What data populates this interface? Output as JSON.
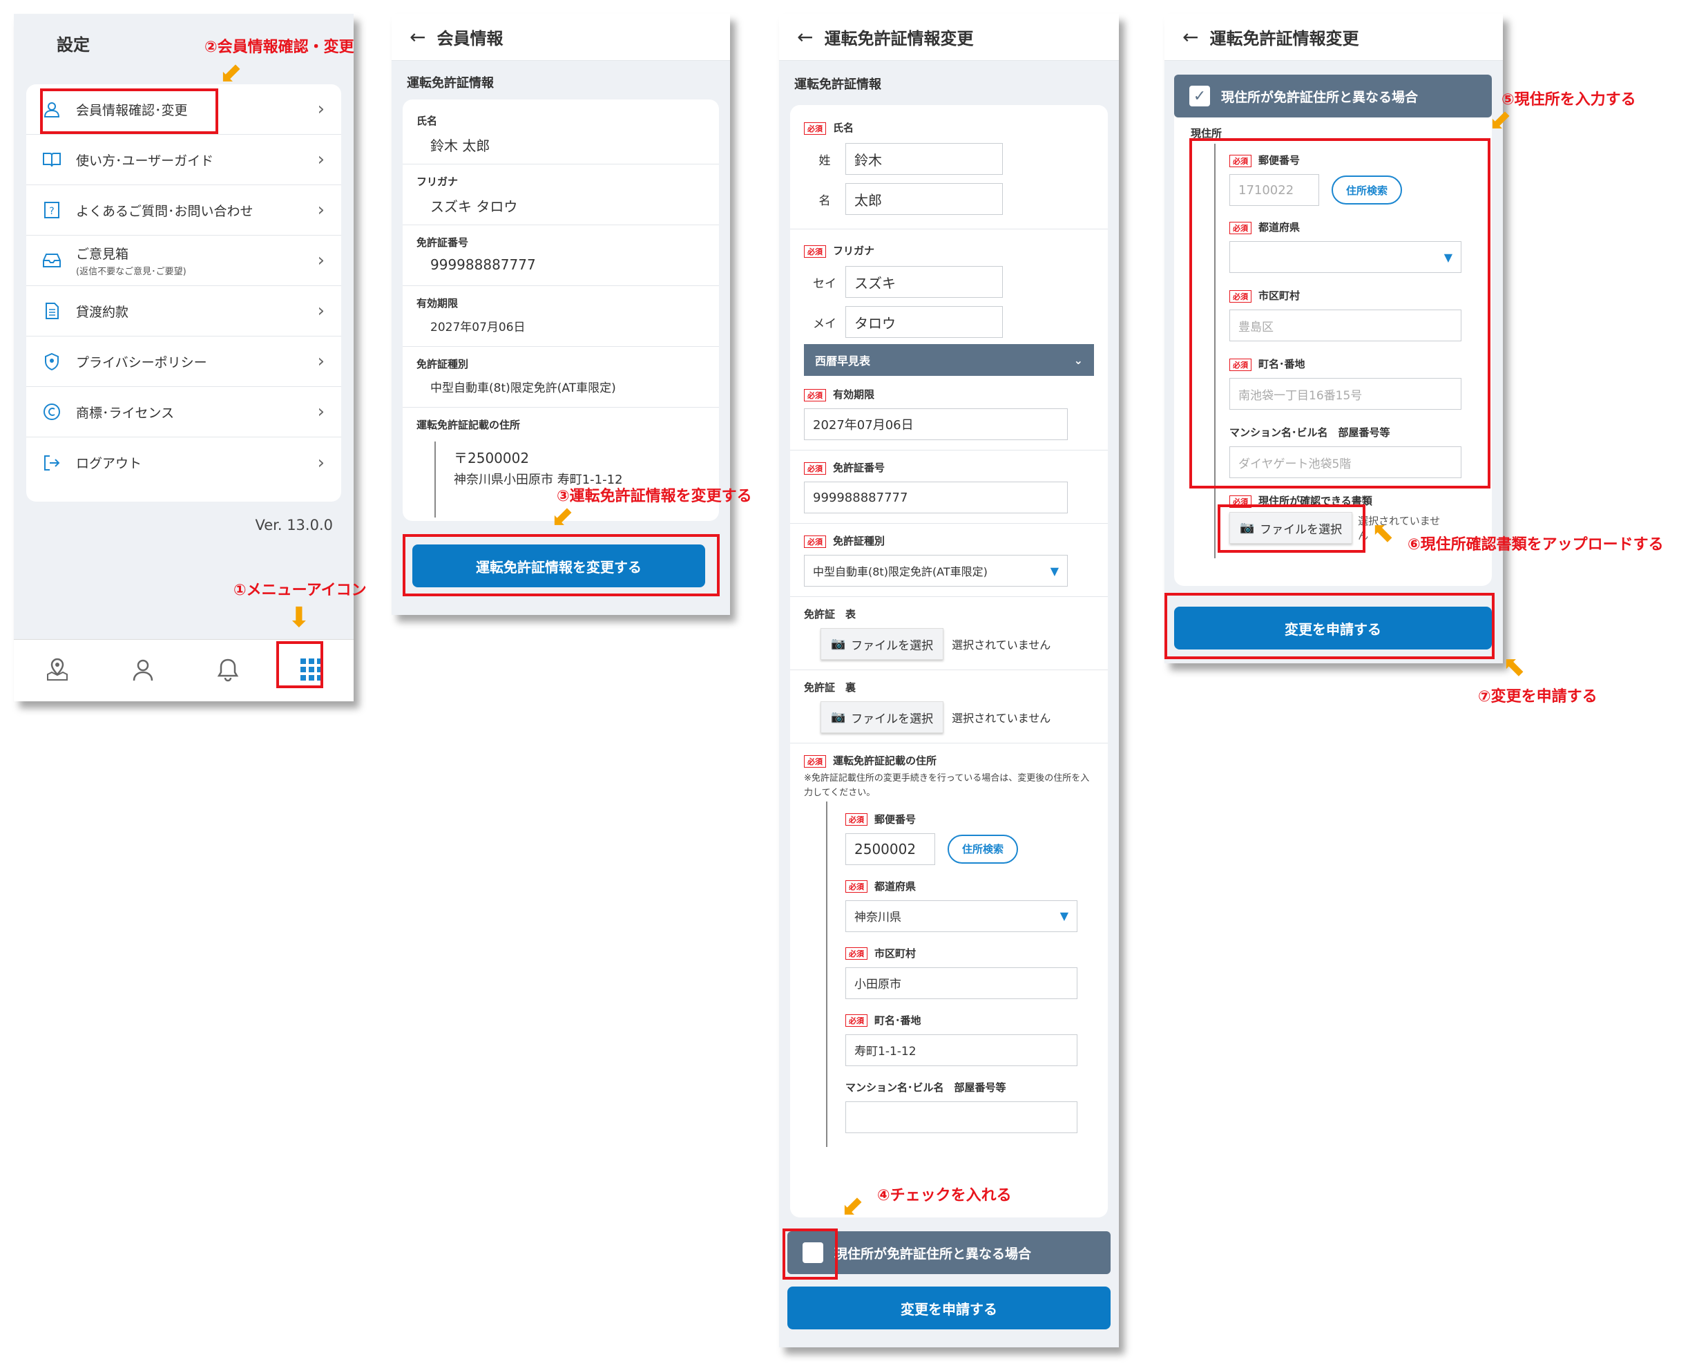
{
  "screen1": {
    "title": "設定",
    "version": "Ver. 13.0.0",
    "items": [
      {
        "label": "会員情報確認･変更",
        "icon": "person-icon"
      },
      {
        "label": "使い方･ユーザーガイド",
        "icon": "book-icon"
      },
      {
        "label": "よくあるご質問･お問い合わせ",
        "icon": "question-icon"
      },
      {
        "label": "ご意見箱",
        "sub": "(返信不要なご意見･ご要望)",
        "icon": "inbox-icon"
      },
      {
        "label": "貸渡約款",
        "icon": "document-icon"
      },
      {
        "label": "プライバシーポリシー",
        "icon": "shield-icon"
      },
      {
        "label": "商標･ライセンス",
        "icon": "copyright-icon"
      },
      {
        "label": "ログアウト",
        "icon": "logout-icon"
      }
    ]
  },
  "screen2": {
    "title": "会員情報",
    "section": "運転免許証情報",
    "fields": [
      {
        "label": "氏名",
        "value": "鈴木 太郎"
      },
      {
        "label": "フリガナ",
        "value": "スズキ タロウ"
      },
      {
        "label": "免許証番号",
        "value": "999988887777"
      },
      {
        "label": "有効期限",
        "value": "2027年07月06日"
      },
      {
        "label": "免許証種別",
        "value": "中型自動車(8t)限定免許(AT車限定)"
      }
    ],
    "address_label": "運転免許証記載の住所",
    "postal": "〒2500002",
    "address": "神奈川県小田原市 寿町1-1-12",
    "button": "運転免許証情報を変更する"
  },
  "screen3": {
    "title": "運転免許証情報変更",
    "section": "運転免許証情報",
    "req": "必須",
    "name_label": "氏名",
    "sei_label": "姓",
    "sei": "鈴木",
    "mei_label": "名",
    "mei": "太郎",
    "kana_label": "フリガナ",
    "kana_sei_label": "セイ",
    "kana_sei": "スズキ",
    "kana_mei_label": "メイ",
    "kana_mei": "タロウ",
    "calendar": "西暦早見表",
    "expiry_label": "有効期限",
    "expiry": "2027年07月06日",
    "number_label": "免許証番号",
    "number": "999988887777",
    "type_label": "免許証種別",
    "type": "中型自動車(8t)限定免許(AT車限定)",
    "front_label": "免許証　表",
    "back_label": "免許証　裏",
    "file_btn": "ファイルを選択",
    "no_file": "選択されていません",
    "addr_label": "運転免許証記載の住所",
    "addr_note": "※免許証記載住所の変更手続きを行っている場合は、変更後の住所を入力してください。",
    "postal_label": "郵便番号",
    "postal": "2500002",
    "search": "住所検索",
    "pref_label": "都道府県",
    "pref": "神奈川県",
    "city_label": "市区町村",
    "city": "小田原市",
    "street_label": "町名･番地",
    "street": "寿町1-1-12",
    "building_label": "マンション名･ビル名　部屋番号等",
    "diff_label": "現住所が免許証住所と異なる場合",
    "submit": "変更を申請する"
  },
  "screen4": {
    "title": "運転免許証情報変更",
    "diff_label": "現住所が免許証住所と異なる場合",
    "current": "現住所",
    "req": "必須",
    "postal_label": "郵便番号",
    "postal_ph": "1710022",
    "search": "住所検索",
    "pref_label": "都道府県",
    "city_label": "市区町村",
    "city_ph": "豊島区",
    "street_label": "町名･番地",
    "street_ph": "南池袋一丁目16番15号",
    "building_label": "マンション名･ビル名　部屋番号等",
    "building_ph": "ダイヤゲート池袋5階",
    "doc_label": "現住所が確認できる書類",
    "file_btn": "ファイルを選択",
    "no_file": "選択されていません",
    "submit": "変更を申請する"
  },
  "annotations": {
    "a1": "①メニューアイコン",
    "a2": "②会員情報確認・変更",
    "a3": "③運転免許証情報を変更する",
    "a4": "④チェックを入れる",
    "a5": "⑤現住所を入力する",
    "a6": "⑥現住所確認書類をアップロードする",
    "a7": "⑦変更を申請する"
  },
  "colors": {
    "accent": "#0b7ac5",
    "annotation": "#e8141c",
    "arrow": "#f5a300",
    "bar": "#5c7288"
  }
}
